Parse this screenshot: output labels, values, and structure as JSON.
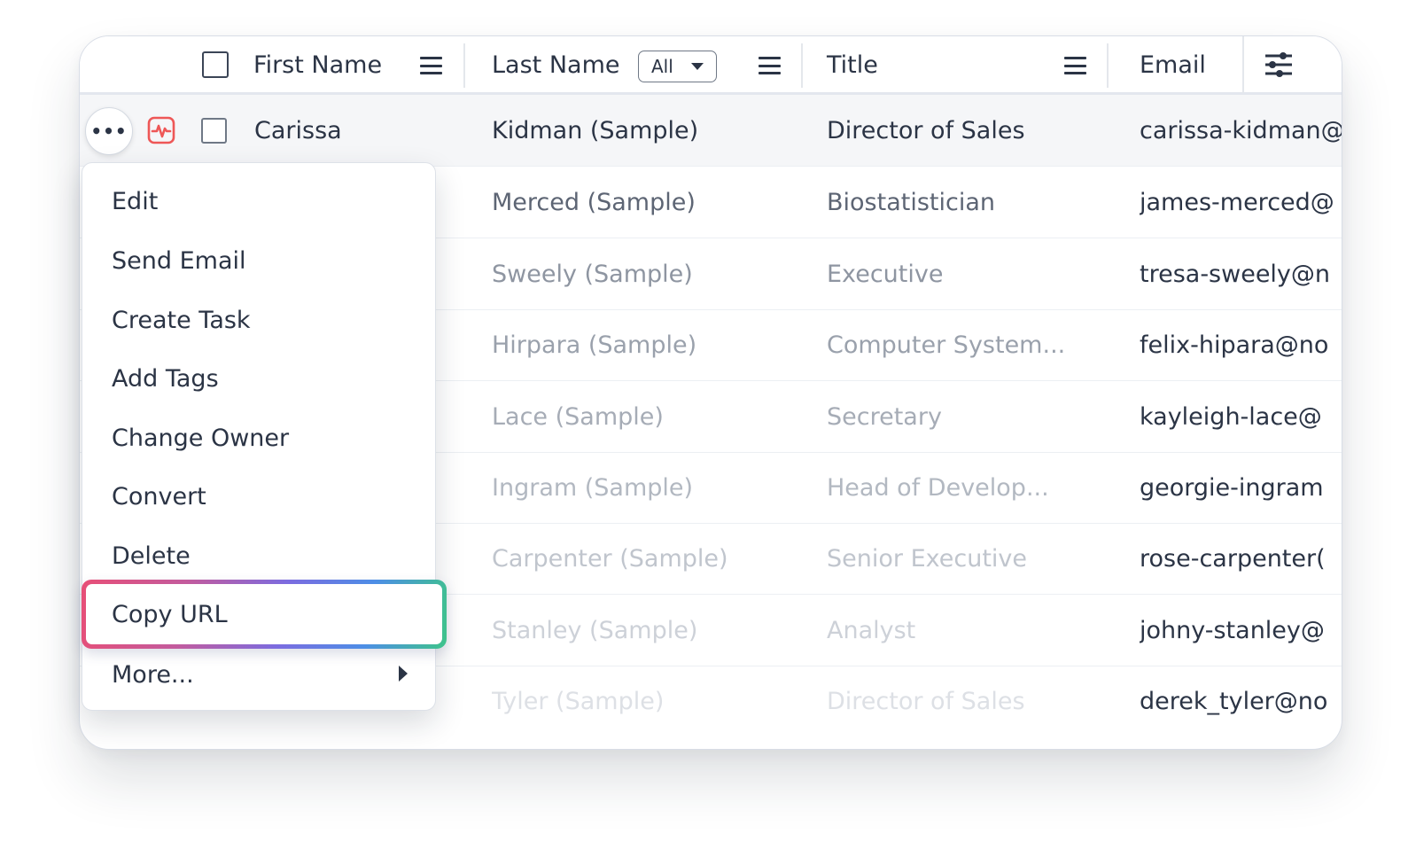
{
  "table": {
    "columns": {
      "first_name": "First Name",
      "last_name": "Last Name",
      "last_name_filter": "All",
      "title": "Title",
      "email": "Email"
    },
    "rows": [
      {
        "first": "Carissa",
        "last": "Kidman (Sample)",
        "title": "Director of Sales",
        "email": "carissa-kidman@"
      },
      {
        "first": "",
        "last": "Merced (Sample)",
        "title": "Biostatistician",
        "email": "james-merced@"
      },
      {
        "first": "",
        "last": "Sweely (Sample)",
        "title": "Executive",
        "email": "tresa-sweely@n"
      },
      {
        "first": "",
        "last": "Hirpara (Sample)",
        "title": "Computer System...",
        "email": "felix-hipara@no"
      },
      {
        "first": "",
        "last": "Lace (Sample)",
        "title": "Secretary",
        "email": "kayleigh-lace@"
      },
      {
        "first": "",
        "last": "Ingram (Sample)",
        "title": "Head of Develop...",
        "email": "georgie-ingram"
      },
      {
        "first": "",
        "last": "Carpenter (Sample)",
        "title": "Senior Executive",
        "email": "rose-carpenter("
      },
      {
        "first": "",
        "last": "Stanley (Sample)",
        "title": "Analyst",
        "email": "johny-stanley@"
      },
      {
        "first": "",
        "last": "Tyler (Sample)",
        "title": "Director of Sales",
        "email": "derek_tyler@no"
      }
    ]
  },
  "row_actions": {
    "more_button": "•••"
  },
  "context_menu": {
    "items": [
      "Edit",
      "Send Email",
      "Create Task",
      "Add Tags",
      "Change Owner",
      "Convert",
      "Delete"
    ],
    "highlighted_item": "Copy URL",
    "more_item": "More..."
  },
  "colors": {
    "text": "#2b3445",
    "activity_icon": "#ee5757",
    "highlight_gradient": [
      "#e84f77",
      "#7b6ce0",
      "#4d8ee6",
      "#3ec48a"
    ]
  },
  "icons": {
    "row_activity": "activity-pulse-icon",
    "column_menu": "hamburger-icon",
    "settings": "sliders-icon",
    "submenu": "caret-right-icon"
  }
}
